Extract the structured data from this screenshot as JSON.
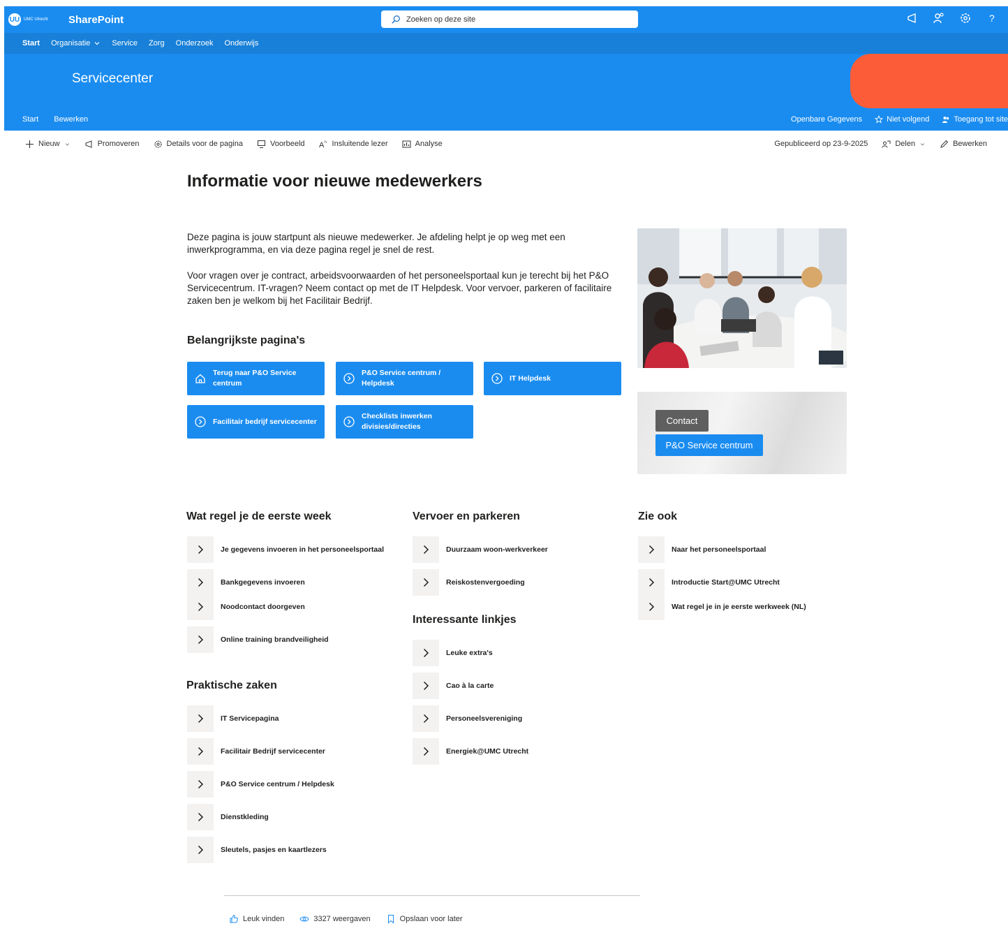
{
  "suitebar": {
    "logo_mark": "UU",
    "logo_text": "UMC Utrecht",
    "app_name": "SharePoint",
    "search_placeholder": "Zoeken op deze site"
  },
  "hubnav": {
    "items": [
      "Start",
      "Organisatie",
      "Service",
      "Zorg",
      "Onderzoek",
      "Onderwijs"
    ]
  },
  "site": {
    "title": "Servicecenter",
    "accent_color": "#fc5c37",
    "brand_color": "#1a8cf0"
  },
  "sitenav": {
    "left": [
      "Start",
      "Bewerken"
    ],
    "right": [
      "Openbare Gegevens",
      "Niet volgend",
      "Toegang tot site"
    ]
  },
  "commandbar": {
    "left": [
      "Nieuw",
      "Promoveren",
      "Details voor de pagina",
      "Voorbeeld",
      "Insluitende lezer",
      "Analyse"
    ],
    "published": "Gepubliceerd op 23-9-2025",
    "share": "Delen",
    "edit": "Bewerken"
  },
  "page": {
    "title": "Informatie voor nieuwe medewerkers",
    "intro_1": "Deze pagina is jouw startpunt als nieuwe medewerker. Je afdeling helpt je op weg met een inwerkprogramma, en via deze pagina regel je snel de rest.",
    "intro_2": "Voor vragen over je contract, arbeidsvoorwaarden of het personeelsportaal kun je terecht bij het P&O Servicecentrum. IT-vragen? Neem contact op met de IT Helpdesk. Voor vervoer, parkeren of facilitaire zaken ben je welkom bij het Facilitair Bedrijf."
  },
  "quicklinks": {
    "heading": "Belangrijkste pagina's",
    "buttons": [
      "Terug naar P&O Service centrum",
      "P&O Service centrum / Helpdesk",
      "IT Helpdesk",
      "Facilitair bedrijf servicecenter",
      "Checklists inwerken divisies/directies"
    ]
  },
  "contact_card": {
    "contact_label": "Contact",
    "po_label": "P&O Service centrum"
  },
  "sections": {
    "eerste_week": {
      "heading": "Wat regel je de eerste week",
      "links": [
        "Je gegevens invoeren in het personeelsportaal",
        "Bankgegevens invoeren",
        "Noodcontact doorgeven",
        "Online training brandveiligheid"
      ]
    },
    "praktisch": {
      "heading": "Praktische zaken",
      "links": [
        "IT Servicepagina",
        "Facilitair Bedrijf servicecenter",
        "P&O Service centrum / Helpdesk",
        "Dienstkleding",
        "Sleutels, pasjes en kaartlezers"
      ]
    },
    "vervoer": {
      "heading": "Vervoer en parkeren",
      "links": [
        "Duurzaam woon-werkverkeer",
        "Reiskostenvergoeding"
      ]
    },
    "interessant": {
      "heading": "Interessante linkjes",
      "links": [
        "Leuke extra's",
        "Cao à la carte",
        "Personeelsvereniging",
        "Energiek@UMC Utrecht"
      ]
    },
    "zie_ook": {
      "heading": "Zie ook",
      "links": [
        "Naar het personeelsportaal",
        "Introductie Start@UMC Utrecht",
        "Wat regel je in je eerste werkweek (NL)"
      ]
    }
  },
  "footer": {
    "like": "Leuk vinden",
    "views": "3327 weergaven",
    "save": "Opslaan voor later"
  }
}
